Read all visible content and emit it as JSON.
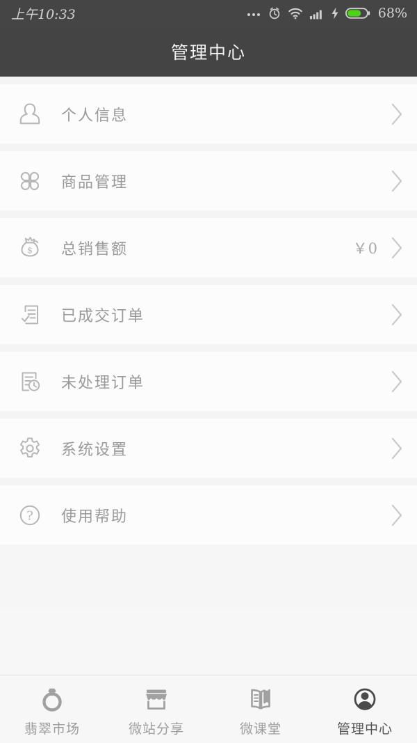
{
  "statusbar": {
    "time": "上午10:33",
    "battery_percent": "68%",
    "icons": [
      "more-dots-icon",
      "alarm-icon",
      "wifi-icon",
      "signal-icon",
      "charging-bolt-icon",
      "battery-icon"
    ],
    "battery_color": "#4cd419",
    "background": "#454545"
  },
  "header": {
    "title": "管理中心",
    "background": "#444444"
  },
  "menu": {
    "items": [
      {
        "id": "profile",
        "icon": "user-icon",
        "label": "个人信息",
        "value": ""
      },
      {
        "id": "products",
        "icon": "clover-grid-icon",
        "label": "商品管理",
        "value": ""
      },
      {
        "id": "total-sales",
        "icon": "money-bag-icon",
        "label": "总销售额",
        "value": "￥0"
      },
      {
        "id": "done-orders",
        "icon": "order-check-icon",
        "label": "已成交订单",
        "value": ""
      },
      {
        "id": "pending-orders",
        "icon": "order-clock-icon",
        "label": "未处理订单",
        "value": ""
      },
      {
        "id": "settings",
        "icon": "gear-icon",
        "label": "系统设置",
        "value": ""
      },
      {
        "id": "help",
        "icon": "question-circle-icon",
        "label": "使用帮助",
        "value": ""
      }
    ]
  },
  "tabbar": {
    "tabs": [
      {
        "id": "market",
        "icon": "ring-icon",
        "label": "翡翠市场",
        "active": false
      },
      {
        "id": "share",
        "icon": "shop-icon",
        "label": "微站分享",
        "active": false
      },
      {
        "id": "class",
        "icon": "book-icon",
        "label": "微课堂",
        "active": false
      },
      {
        "id": "manage",
        "icon": "person-circle-icon",
        "label": "管理中心",
        "active": true
      }
    ]
  }
}
